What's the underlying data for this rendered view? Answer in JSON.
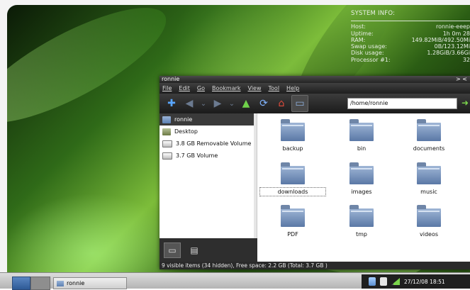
{
  "system_info": {
    "title": "SYSTEM INFO:",
    "rows": [
      {
        "label": "Host:",
        "value": "ronnie-eeep"
      },
      {
        "label": "Uptime:",
        "value": "1h 0m 28"
      },
      {
        "label": "RAM:",
        "value": "149.82MiB/492.50Mi"
      },
      {
        "label": "Swap usage:",
        "value": "0B/123.12Mi"
      },
      {
        "label": "Disk usage:",
        "value": "1.28GiB/3.66Gi"
      },
      {
        "label": "Processor #1:",
        "value": "32"
      }
    ]
  },
  "window": {
    "title": "ronnie",
    "controls": "> <",
    "menu": [
      "File",
      "Edit",
      "Go",
      "Bookmark",
      "View",
      "Tool",
      "Help"
    ],
    "location": "/home/ronnie",
    "toolbar_icons": [
      "new-tab-icon",
      "back-icon",
      "back-history-icon",
      "forward-icon",
      "forward-history-icon",
      "up-icon",
      "reload-icon",
      "home-icon",
      "folder-view-icon",
      "go-icon"
    ],
    "sidebar": [
      {
        "label": "ronnie",
        "icon": "home-folder-icon",
        "selected": true
      },
      {
        "label": "Desktop",
        "icon": "desktop-icon",
        "selected": false
      },
      {
        "label": "3.8 GB Removable Volume",
        "icon": "drive-icon",
        "selected": false
      },
      {
        "label": "3.7 GB Volume",
        "icon": "drive-icon",
        "selected": false
      }
    ],
    "files": [
      "backup",
      "bin",
      "documents",
      "downloads",
      "images",
      "music",
      "PDF",
      "tmp",
      "videos"
    ],
    "status": "9 visible items (34 hidden), Free space: 2.2 GB (Total: 3.7 GB )"
  },
  "taskbar": {
    "task_label": "ronnie",
    "clock": "27/12/08 18:51"
  }
}
